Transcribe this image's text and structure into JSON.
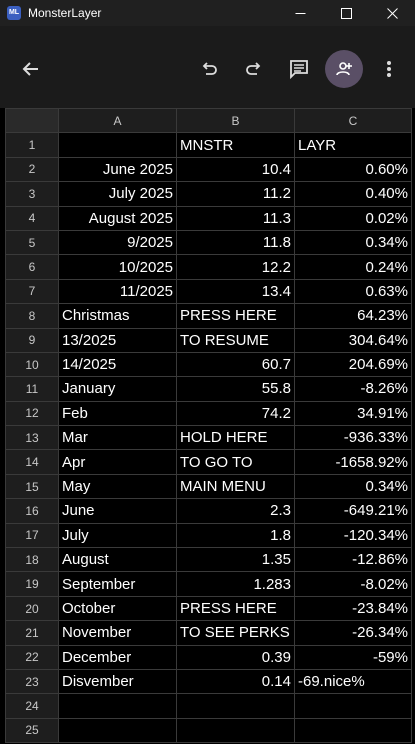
{
  "window": {
    "title": "MonsterLayer",
    "icon_label": "ML"
  },
  "toolbar": {
    "icons": [
      "back-arrow-icon",
      "undo-icon",
      "redo-icon",
      "comment-icon",
      "add-person-icon",
      "more-vert-icon"
    ]
  },
  "sheet": {
    "columns": [
      "A",
      "B",
      "C"
    ],
    "rows": [
      {
        "n": "1",
        "a": "",
        "a_align": "left",
        "b": "MNSTR",
        "b_align": "left",
        "c": "LAYR",
        "c_align": "left"
      },
      {
        "n": "2",
        "a": "June 2025",
        "a_align": "right",
        "b": "10.4",
        "b_align": "right",
        "c": "0.60%",
        "c_align": "right"
      },
      {
        "n": "3",
        "a": "July 2025",
        "a_align": "right",
        "b": "11.2",
        "b_align": "right",
        "c": "0.40%",
        "c_align": "right"
      },
      {
        "n": "4",
        "a": "August 2025",
        "a_align": "right",
        "b": "11.3",
        "b_align": "right",
        "c": "0.02%",
        "c_align": "right"
      },
      {
        "n": "5",
        "a": "9/2025",
        "a_align": "right",
        "b": "11.8",
        "b_align": "right",
        "c": "0.34%",
        "c_align": "right"
      },
      {
        "n": "6",
        "a": "10/2025",
        "a_align": "right",
        "b": "12.2",
        "b_align": "right",
        "c": "0.24%",
        "c_align": "right"
      },
      {
        "n": "7",
        "a": "11/2025",
        "a_align": "right",
        "b": "13.4",
        "b_align": "right",
        "c": "0.63%",
        "c_align": "right"
      },
      {
        "n": "8",
        "a": "Christmas",
        "a_align": "left",
        "b": "PRESS HERE",
        "b_align": "left",
        "c": "64.23%",
        "c_align": "right"
      },
      {
        "n": "9",
        "a": "13/2025",
        "a_align": "left",
        "b": "TO RESUME",
        "b_align": "left",
        "c": "304.64%",
        "c_align": "right"
      },
      {
        "n": "10",
        "a": "14/2025",
        "a_align": "left",
        "b": "60.7",
        "b_align": "right",
        "c": "204.69%",
        "c_align": "right"
      },
      {
        "n": "11",
        "a": "January",
        "a_align": "left",
        "b": "55.8",
        "b_align": "right",
        "c": "-8.26%",
        "c_align": "right"
      },
      {
        "n": "12",
        "a": "Feb",
        "a_align": "left",
        "b": "74.2",
        "b_align": "right",
        "c": "34.91%",
        "c_align": "right"
      },
      {
        "n": "13",
        "a": "Mar",
        "a_align": "left",
        "b": "HOLD HERE",
        "b_align": "left",
        "c": "-936.33%",
        "c_align": "right"
      },
      {
        "n": "14",
        "a": "Apr",
        "a_align": "left",
        "b": "TO GO TO",
        "b_align": "left",
        "c": "-1658.92%",
        "c_align": "right"
      },
      {
        "n": "15",
        "a": "May",
        "a_align": "left",
        "b": "MAIN MENU",
        "b_align": "left",
        "c": "0.34%",
        "c_align": "right"
      },
      {
        "n": "16",
        "a": "June",
        "a_align": "left",
        "b": "2.3",
        "b_align": "right",
        "c": "-649.21%",
        "c_align": "right"
      },
      {
        "n": "17",
        "a": "July",
        "a_align": "left",
        "b": "1.8",
        "b_align": "right",
        "c": "-120.34%",
        "c_align": "right"
      },
      {
        "n": "18",
        "a": "August",
        "a_align": "left",
        "b": "1.35",
        "b_align": "right",
        "c": "-12.86%",
        "c_align": "right"
      },
      {
        "n": "19",
        "a": "September",
        "a_align": "left",
        "b": "1.283",
        "b_align": "right",
        "c": "-8.02%",
        "c_align": "right"
      },
      {
        "n": "20",
        "a": "October",
        "a_align": "left",
        "b": "PRESS HERE",
        "b_align": "left",
        "c": "-23.84%",
        "c_align": "right"
      },
      {
        "n": "21",
        "a": "November",
        "a_align": "left",
        "b": "TO SEE PERKS",
        "b_align": "left",
        "c": "-26.34%",
        "c_align": "right"
      },
      {
        "n": "22",
        "a": "December",
        "a_align": "left",
        "b": "0.39",
        "b_align": "right",
        "c": "-59%",
        "c_align": "right"
      },
      {
        "n": "23",
        "a": "Disvember",
        "a_align": "left",
        "b": "0.14",
        "b_align": "right",
        "c": "-69.nice%",
        "c_align": "left"
      },
      {
        "n": "24",
        "a": "",
        "a_align": "left",
        "b": "",
        "b_align": "left",
        "c": "",
        "c_align": "left"
      },
      {
        "n": "25",
        "a": "",
        "a_align": "left",
        "b": "",
        "b_align": "left",
        "c": "",
        "c_align": "left"
      }
    ]
  }
}
